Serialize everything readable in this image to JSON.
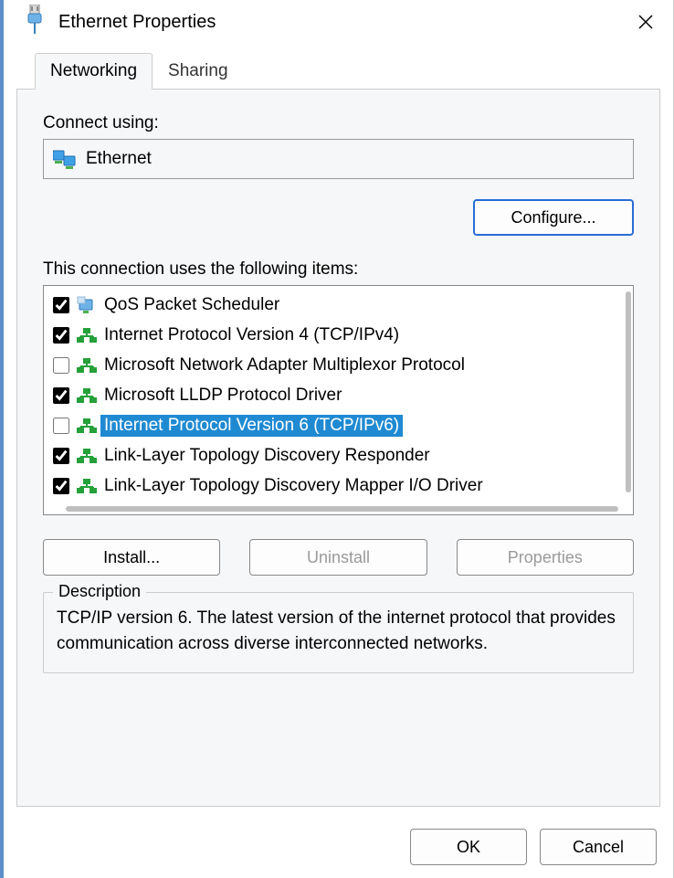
{
  "window": {
    "title": "Ethernet Properties"
  },
  "tabs": {
    "networking": "Networking",
    "sharing": "Sharing",
    "active": "networking"
  },
  "connect": {
    "label": "Connect using:",
    "adapter": "Ethernet",
    "configure": "Configure..."
  },
  "items_caption": "This connection uses the following items:",
  "items": [
    {
      "checked": true,
      "icon": "qos",
      "label": "QoS Packet Scheduler",
      "selected": false
    },
    {
      "checked": true,
      "icon": "proto",
      "label": "Internet Protocol Version 4 (TCP/IPv4)",
      "selected": false
    },
    {
      "checked": false,
      "icon": "proto",
      "label": "Microsoft Network Adapter Multiplexor Protocol",
      "selected": false
    },
    {
      "checked": true,
      "icon": "proto",
      "label": "Microsoft LLDP Protocol Driver",
      "selected": false
    },
    {
      "checked": false,
      "icon": "proto",
      "label": "Internet Protocol Version 6 (TCP/IPv6)",
      "selected": true
    },
    {
      "checked": true,
      "icon": "proto",
      "label": "Link-Layer Topology Discovery Responder",
      "selected": false
    },
    {
      "checked": true,
      "icon": "proto",
      "label": "Link-Layer Topology Discovery Mapper I/O Driver",
      "selected": false
    }
  ],
  "buttons": {
    "install": "Install...",
    "uninstall": "Uninstall",
    "properties": "Properties",
    "ok": "OK",
    "cancel": "Cancel"
  },
  "description": {
    "legend": "Description",
    "text": "TCP/IP version 6. The latest version of the internet protocol that provides communication across diverse interconnected networks."
  }
}
